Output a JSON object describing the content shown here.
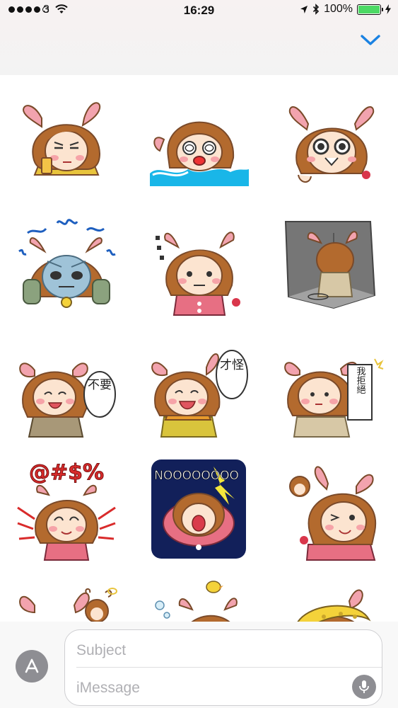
{
  "status_bar": {
    "carrier": "3",
    "time": "16:29",
    "battery": "100%",
    "battery_level": 1.0,
    "icons": [
      "signal-dots",
      "wifi-icon",
      "location-icon",
      "bluetooth-icon",
      "battery-icon",
      "charging-icon"
    ]
  },
  "header": {
    "collapse_icon": "chevron-down-icon",
    "accent": "#1a82e2"
  },
  "stickers": [
    {
      "id": "annoyed-phone"
    },
    {
      "id": "drowning-shock"
    },
    {
      "id": "scared-cry"
    },
    {
      "id": "blue-fear"
    },
    {
      "id": "speechless-dots"
    },
    {
      "id": "sulking-corner"
    },
    {
      "id": "refuse-bubble",
      "text": "不要"
    },
    {
      "id": "no-way-bubble",
      "text": "才怪"
    },
    {
      "id": "reject-sign",
      "text": "我拒絕"
    },
    {
      "id": "angry-symbols",
      "text": "@#$%"
    },
    {
      "id": "screaming-no",
      "text": "NOOOOOOOO"
    },
    {
      "id": "peek-wink"
    },
    {
      "id": "dizzy-friend"
    },
    {
      "id": "bubble-bath"
    },
    {
      "id": "hair-dryer"
    }
  ],
  "compose": {
    "subject_placeholder": "Subject",
    "message_placeholder": "iMessage",
    "app_icon": "app-store-icon",
    "mic_icon": "microphone-icon"
  }
}
